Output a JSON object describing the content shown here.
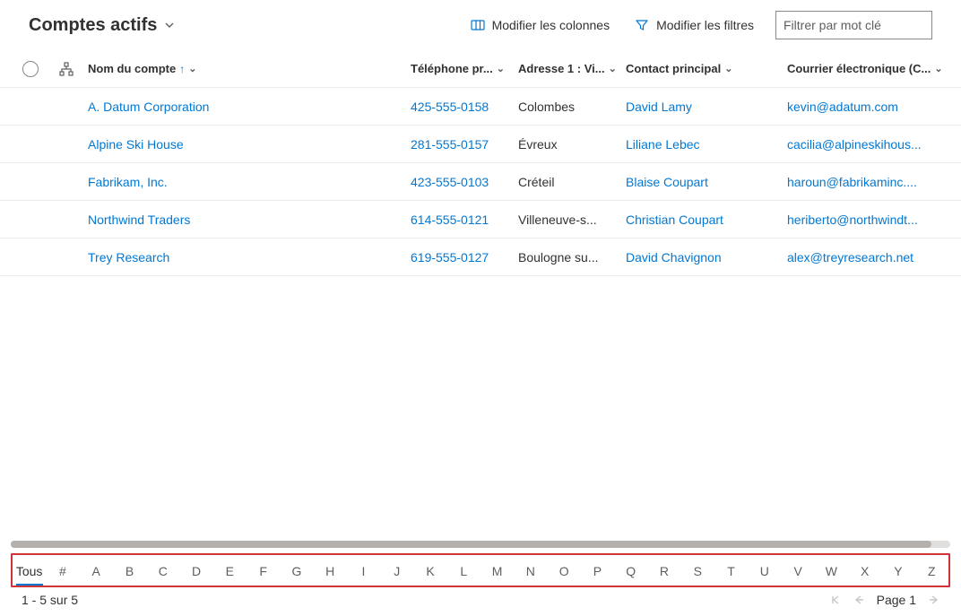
{
  "header": {
    "view_title": "Comptes actifs",
    "edit_columns_label": "Modifier les colonnes",
    "edit_filters_label": "Modifier les filtres",
    "filter_placeholder": "Filtrer par mot clé"
  },
  "columns": {
    "name": "Nom du compte",
    "phone": "Téléphone pr...",
    "city": "Adresse 1 : Vi...",
    "contact": "Contact principal",
    "email": "Courrier électronique (C..."
  },
  "rows": [
    {
      "name": "A. Datum Corporation",
      "phone": "425-555-0158",
      "city": "Colombes",
      "contact": "David Lamy",
      "email": "kevin@adatum.com"
    },
    {
      "name": "Alpine Ski House",
      "phone": "281-555-0157",
      "city": "Évreux",
      "contact": "Liliane Lebec",
      "email": "cacilia@alpineskihous..."
    },
    {
      "name": "Fabrikam, Inc.",
      "phone": "423-555-0103",
      "city": "Créteil",
      "contact": "Blaise Coupart",
      "email": "haroun@fabrikaminc...."
    },
    {
      "name": "Northwind Traders",
      "phone": "614-555-0121",
      "city": "Villeneuve-s...",
      "contact": "Christian Coupart",
      "email": "heriberto@northwindt..."
    },
    {
      "name": "Trey Research",
      "phone": "619-555-0127",
      "city": "Boulogne su...",
      "contact": "David Chavignon",
      "email": "alex@treyresearch.net"
    }
  ],
  "alpha": {
    "all_label": "Tous",
    "active": "Tous",
    "items": [
      "#",
      "A",
      "B",
      "C",
      "D",
      "E",
      "F",
      "G",
      "H",
      "I",
      "J",
      "K",
      "L",
      "M",
      "N",
      "O",
      "P",
      "Q",
      "R",
      "S",
      "T",
      "U",
      "V",
      "W",
      "X",
      "Y",
      "Z"
    ]
  },
  "footer": {
    "range_text": "1 - 5 sur 5",
    "page_label": "Page 1"
  }
}
